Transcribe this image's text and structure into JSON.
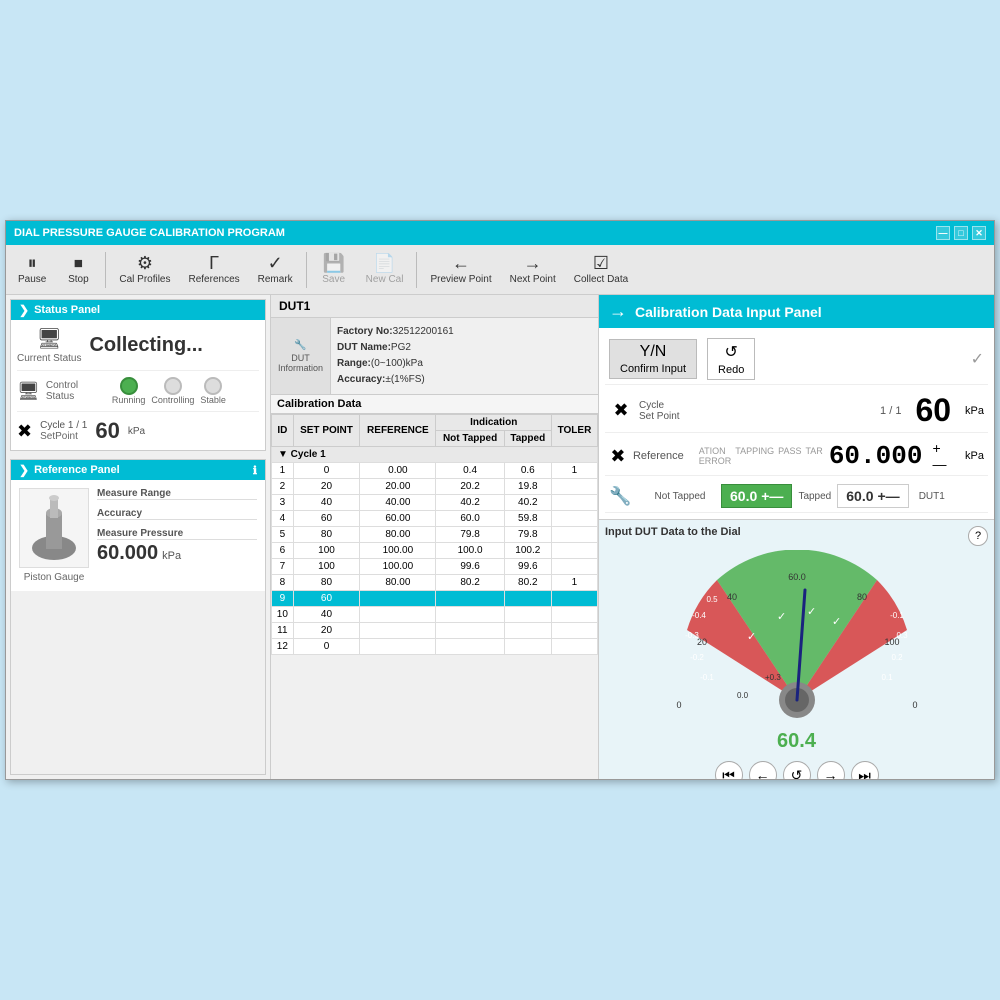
{
  "window": {
    "title": "DIAL PRESSURE GAUGE CALIBRATION PROGRAM",
    "controls": [
      "—",
      "□",
      "✕"
    ]
  },
  "toolbar": {
    "pause_label": "Pause",
    "stop_label": "Stop",
    "cal_profiles_label": "Cal Profiles",
    "references_label": "References",
    "remark_label": "Remark",
    "save_label": "Save",
    "new_cal_label": "New Cal",
    "preview_point_label": "Preview Point",
    "next_point_label": "Next Point",
    "collect_data_label": "Collect Data"
  },
  "status_panel": {
    "title": "Status Panel",
    "current_status_label": "Current Status",
    "collecting_text": "Collecting...",
    "control_status_label": "Control Status",
    "running_label": "Running",
    "controlling_label": "Controlling",
    "stable_label": "Stable",
    "cycle_label": "Cycle",
    "cycle_value": "1 / 1",
    "setpoint_label": "SetPoint",
    "setpoint_value": "60",
    "setpoint_unit": "kPa"
  },
  "reference_panel": {
    "title": "Reference Panel",
    "info_icon": "ℹ",
    "measure_range_label": "Measure Range",
    "accuracy_label": "Accuracy",
    "measure_pressure_label": "Measure Pressure",
    "pressure_value": "60.000",
    "pressure_unit": "kPa",
    "piston_label": "Piston Gauge"
  },
  "dut": {
    "title": "DUT1",
    "factory_no_label": "Factory No:",
    "factory_no_value": "32512200161",
    "dut_name_label": "DUT Name:",
    "dut_name_value": "PG2",
    "range_label": "Range:",
    "range_value": "(0~100)kPa",
    "accuracy_label": "Accuracy:",
    "accuracy_value": "±(1%FS)",
    "dut_info_icon": "🔧",
    "dut_info_label": "DUT\nInformation"
  },
  "calibration_data": {
    "title": "Calibration Data",
    "columns": [
      "ID",
      "SET POINT",
      "REFERENCE",
      "Not Tapped",
      "Tapped",
      "TOLER"
    ],
    "indication_header": "Indication",
    "cycle_label": "Cycle 1",
    "rows": [
      {
        "id": 1,
        "set_point": 0,
        "reference": "0.00",
        "not_tapped": "0.4",
        "tapped": "0.6",
        "toler": "1",
        "highlighted": false
      },
      {
        "id": 2,
        "set_point": 20,
        "reference": "20.00",
        "not_tapped": "20.2",
        "tapped": "19.8",
        "toler": "",
        "highlighted": false
      },
      {
        "id": 3,
        "set_point": 40,
        "reference": "40.00",
        "not_tapped": "40.2",
        "tapped": "40.2",
        "toler": "",
        "highlighted": false
      },
      {
        "id": 4,
        "set_point": 60,
        "reference": "60.00",
        "not_tapped": "60.0",
        "tapped": "59.8",
        "toler": "",
        "highlighted": false
      },
      {
        "id": 5,
        "set_point": 80,
        "reference": "80.00",
        "not_tapped": "79.8",
        "tapped": "79.8",
        "toler": "",
        "highlighted": false
      },
      {
        "id": 6,
        "set_point": 100,
        "reference": "100.00",
        "not_tapped": "100.0",
        "tapped": "100.2",
        "toler": "",
        "highlighted": false
      },
      {
        "id": 7,
        "set_point": 100,
        "reference": "100.00",
        "not_tapped": "99.6",
        "tapped": "99.6",
        "toler": "",
        "highlighted": false
      },
      {
        "id": 8,
        "set_point": 80,
        "reference": "80.00",
        "not_tapped": "80.2",
        "tapped": "80.2",
        "toler": "1",
        "highlighted": false
      },
      {
        "id": 9,
        "set_point": 60,
        "reference": "",
        "not_tapped": "",
        "tapped": "",
        "toler": "",
        "highlighted": true
      },
      {
        "id": 10,
        "set_point": 40,
        "reference": "",
        "not_tapped": "",
        "tapped": "",
        "toler": "",
        "highlighted": false
      },
      {
        "id": 11,
        "set_point": 20,
        "reference": "",
        "not_tapped": "",
        "tapped": "",
        "toler": "",
        "highlighted": false
      },
      {
        "id": 12,
        "set_point": 0,
        "reference": "",
        "not_tapped": "",
        "tapped": "",
        "toler": "",
        "highlighted": false
      }
    ]
  },
  "cal_input_panel": {
    "title": "Calibration Data Input Panel",
    "confirm_input_label": "Confirm Input",
    "redo_label": "Redo",
    "cycle_label": "Cycle",
    "cycle_value": "1 / 1",
    "set_point_label": "Set Point",
    "set_point_value": "60",
    "set_point_unit": "kPa",
    "reference_label": "Reference",
    "reference_value": "60.000",
    "reference_unit": "kPa",
    "col_labels": [
      "ATION ERROR",
      "TAPPING",
      "PASS",
      "TAR"
    ],
    "not_tapped_label": "Not Tapped",
    "not_tapped_value": "60.0",
    "not_tapped_pm": "+—",
    "tapped_label": "Tapped",
    "tapped_value": "60.0",
    "tapped_pm": "+—",
    "dut_label": "DUT1"
  },
  "gauge": {
    "title": "Input DUT Data to the Dial",
    "value": "60.4",
    "help_icon": "?",
    "controls": [
      "⏮",
      "←",
      "↺",
      "→",
      "⏭"
    ],
    "scale_labels": [
      "0",
      "20",
      "40",
      "60",
      "80",
      "100"
    ]
  }
}
